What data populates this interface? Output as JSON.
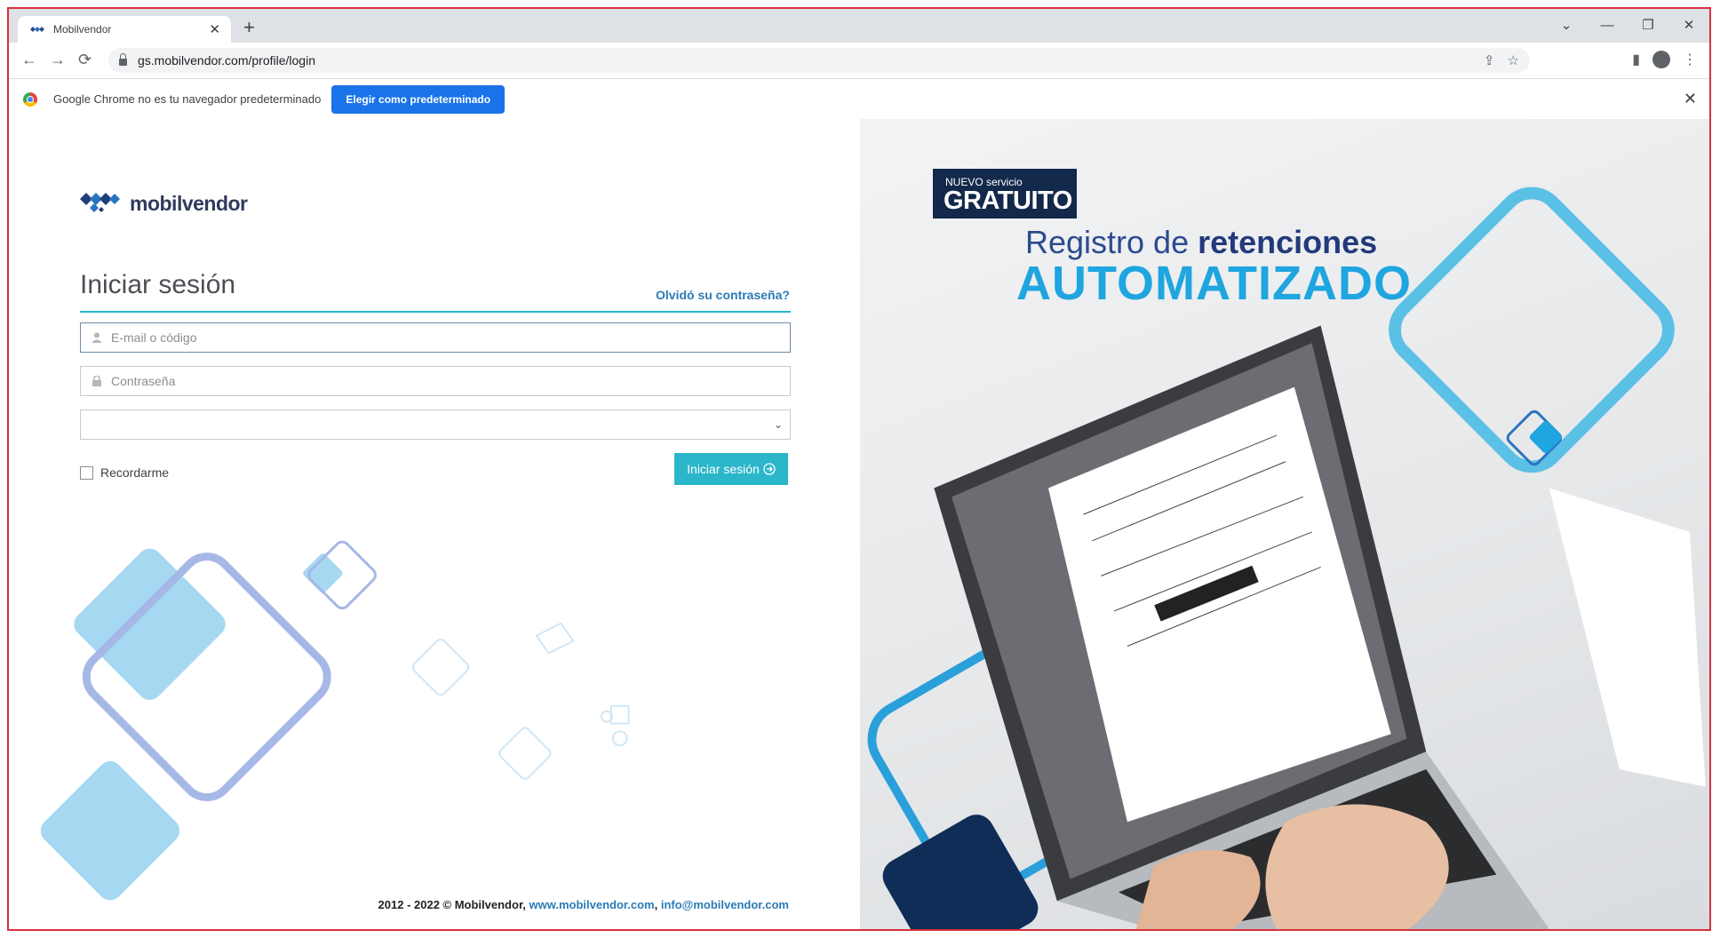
{
  "browser": {
    "tab_title": "Mobilvendor",
    "url": "gs.mobilvendor.com/profile/login",
    "new_tab": "+",
    "tab_close": "✕",
    "window_controls": [
      "⌄",
      "—",
      "❐",
      "✕"
    ]
  },
  "infobar": {
    "text": "Google Chrome no es tu navegador predeterminado",
    "button": "Elegir como predeterminado",
    "close": "✕"
  },
  "login": {
    "brand": "mobilvendor",
    "title": "Iniciar sesión",
    "forgot": "Olvidó su contraseña?",
    "email_placeholder": "E-mail o código",
    "password_placeholder": "Contraseña",
    "select_value": "",
    "remember": "Recordarme",
    "submit": "Iniciar sesión"
  },
  "footer": {
    "copyright": "2012 - 2022 © Mobilvendor, ",
    "site": "www.mobilvendor.com",
    "sep": ", ",
    "email": "info@mobilvendor.com"
  },
  "promo": {
    "badge_small": "NUEVO servicio",
    "badge_large": "GRATUITO",
    "line1_a": "Registro de ",
    "line1_b": "retenciones",
    "line2": "AUTOMATIZADO"
  },
  "colors": {
    "accent": "#2bb7c9",
    "link": "#2a7bb5",
    "chrome_button": "#1a73e8",
    "promo_blue": "#1fa5df",
    "navy": "#13294b"
  }
}
